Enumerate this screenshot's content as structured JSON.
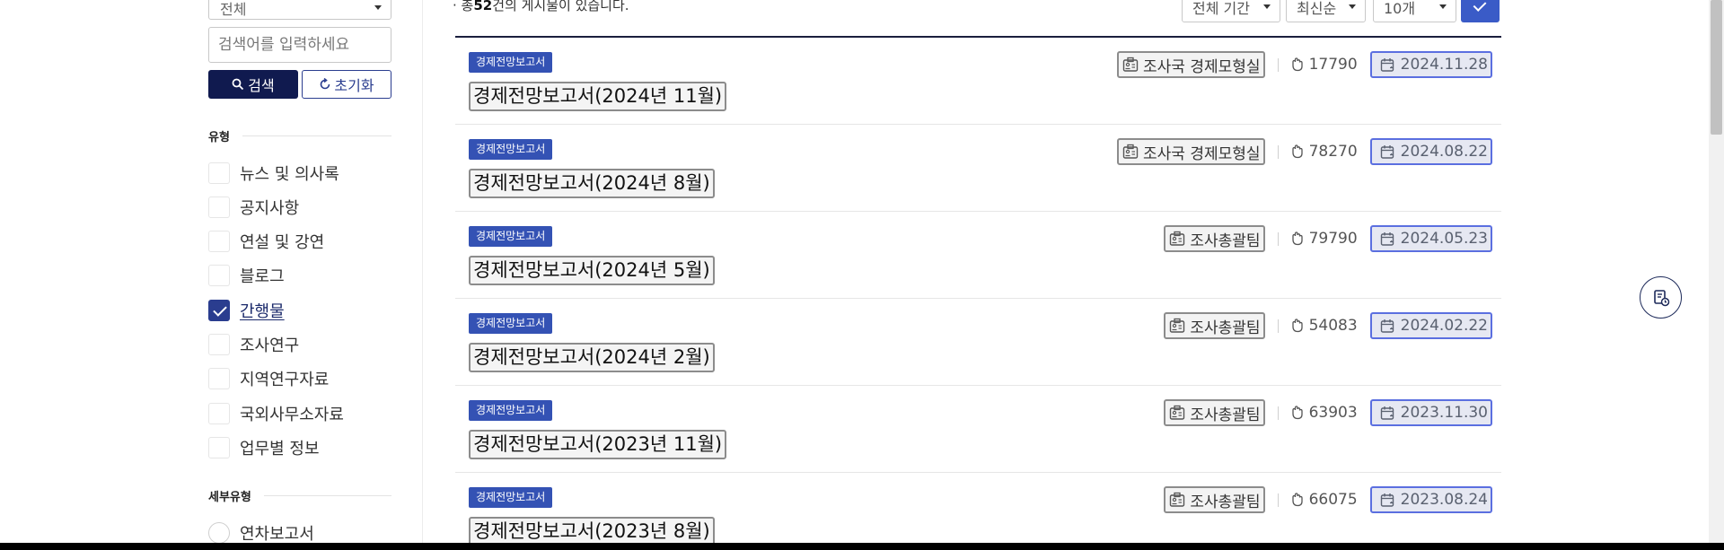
{
  "sidebar": {
    "period_select": "전체",
    "search": {
      "placeholder": "검색어를 입력하세요"
    },
    "search_button": "검색",
    "reset_button": "초기화",
    "type_section": {
      "title": "유형",
      "items": [
        {
          "label": "뉴스 및 의사록",
          "checked": false
        },
        {
          "label": "공지사항",
          "checked": false
        },
        {
          "label": "연설 및 강연",
          "checked": false
        },
        {
          "label": "블로그",
          "checked": false
        },
        {
          "label": "간행물",
          "checked": true
        },
        {
          "label": "조사연구",
          "checked": false
        },
        {
          "label": "지역연구자료",
          "checked": false
        },
        {
          "label": "국외사무소자료",
          "checked": false
        },
        {
          "label": "업무별 정보",
          "checked": false
        }
      ]
    },
    "subtype_section": {
      "title": "세부유형",
      "items": [
        {
          "label": "연차보고서"
        }
      ]
    }
  },
  "main": {
    "total": {
      "prefix": "총",
      "count": "52",
      "suffix": "건의 게시물이 있습니다."
    },
    "period_filter": "전체 기간",
    "sort_filter": "최신순",
    "page_size": "10개",
    "posts": [
      {
        "category": "경제전망보고서",
        "title": "경제전망보고서(2024년 11월)",
        "dept": "조사국 경제모형실",
        "views": "17790",
        "date": "2024.11.28"
      },
      {
        "category": "경제전망보고서",
        "title": "경제전망보고서(2024년 8월)",
        "dept": "조사국 경제모형실",
        "views": "78270",
        "date": "2024.08.22"
      },
      {
        "category": "경제전망보고서",
        "title": "경제전망보고서(2024년 5월)",
        "dept": "조사총괄팀",
        "views": "79790",
        "date": "2024.05.23"
      },
      {
        "category": "경제전망보고서",
        "title": "경제전망보고서(2024년 2월)",
        "dept": "조사총괄팀",
        "views": "54083",
        "date": "2024.02.22"
      },
      {
        "category": "경제전망보고서",
        "title": "경제전망보고서(2023년 11월)",
        "dept": "조사총괄팀",
        "views": "63903",
        "date": "2023.11.30"
      },
      {
        "category": "경제전망보고서",
        "title": "경제전망보고서(2023년 8월)",
        "dept": "조사총괄팀",
        "views": "66075",
        "date": "2023.08.24"
      }
    ]
  },
  "colors": {
    "primary_dark": "#101a4f",
    "primary": "#3452b4",
    "date_border": "#5b6fe0"
  },
  "icons": {
    "search": "search-icon",
    "reset": "refresh-icon",
    "dept": "department-icon",
    "views": "views-icon",
    "date": "calendar-icon",
    "floating": "document-clock-icon"
  }
}
